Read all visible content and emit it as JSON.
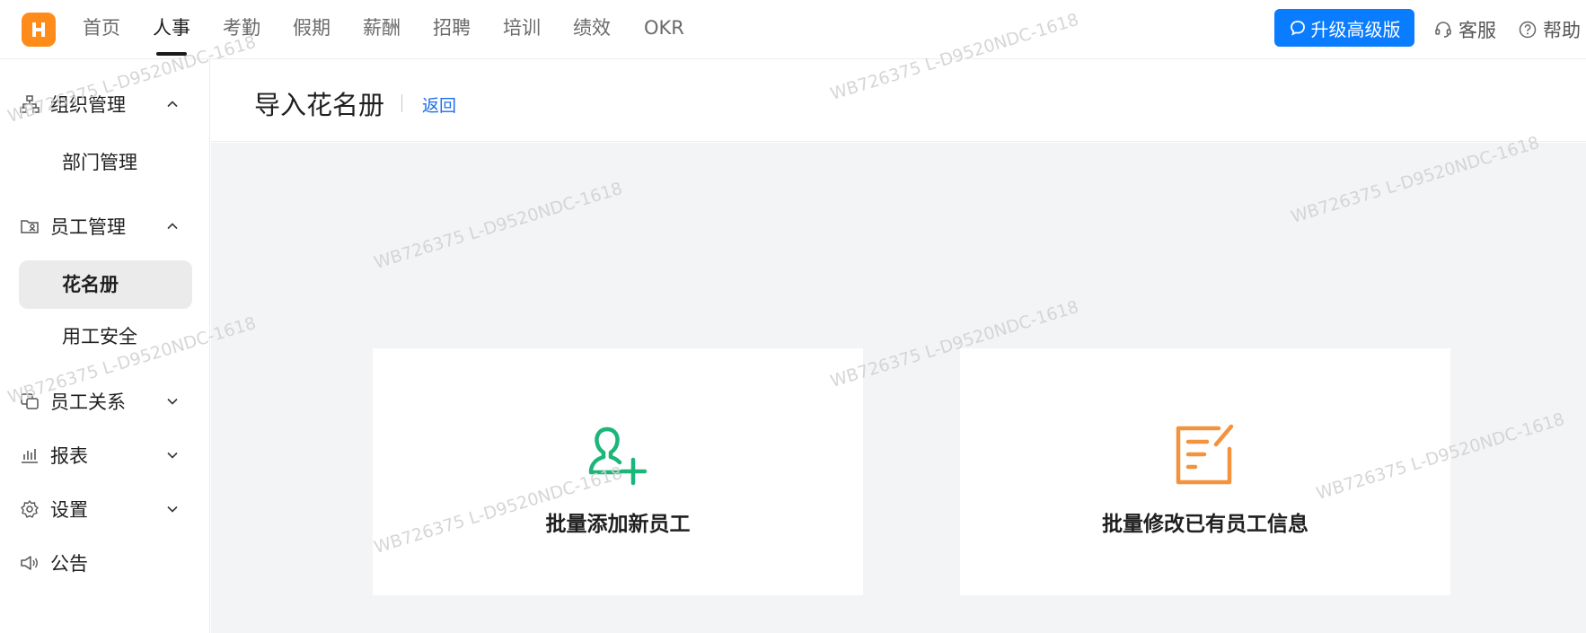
{
  "nav": {
    "items": [
      {
        "label": "首页"
      },
      {
        "label": "人事",
        "active": true
      },
      {
        "label": "考勤"
      },
      {
        "label": "假期"
      },
      {
        "label": "薪酬"
      },
      {
        "label": "招聘"
      },
      {
        "label": "培训"
      },
      {
        "label": "绩效"
      },
      {
        "label": "OKR"
      }
    ],
    "upgrade_label": "升级高级版",
    "service_label": "客服",
    "help_label": "帮助"
  },
  "sidebar": {
    "groups": [
      {
        "label": "组织管理",
        "icon": "org-chart-icon",
        "expanded": true
      },
      {
        "label": "员工管理",
        "icon": "employee-folder-icon",
        "expanded": true
      },
      {
        "label": "员工关系",
        "icon": "relations-icon",
        "expanded": false
      },
      {
        "label": "报表",
        "icon": "bar-chart-icon",
        "expanded": false
      },
      {
        "label": "设置",
        "icon": "gear-icon",
        "expanded": false
      },
      {
        "label": "公告",
        "icon": "speaker-icon"
      }
    ],
    "subitems": [
      {
        "label": "部门管理"
      },
      {
        "label": "花名册",
        "active": true
      },
      {
        "label": "用工安全"
      }
    ]
  },
  "page": {
    "title": "导入花名册",
    "back_label": "返回"
  },
  "cards": [
    {
      "label": "批量添加新员工",
      "icon": "add-user-icon",
      "color": "#1cb57a"
    },
    {
      "label": "批量修改已有员工信息",
      "icon": "edit-doc-icon",
      "color": "#f5923e"
    }
  ],
  "watermark": "WB726375 L-D9520NDC-1618",
  "colors": {
    "brand": "#ff8c1a",
    "primary": "#0a7cff",
    "link": "#1a6ee8"
  }
}
